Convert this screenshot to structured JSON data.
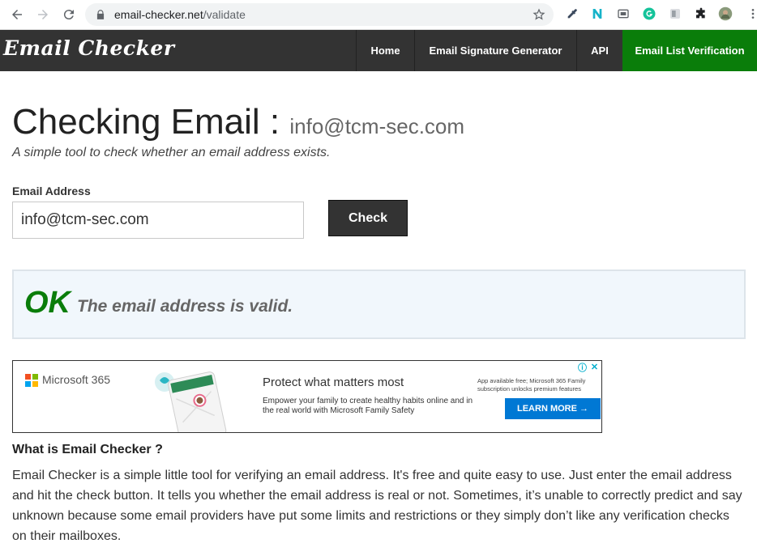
{
  "browser": {
    "url_host": "email-checker.net",
    "url_path": "/validate"
  },
  "site": {
    "logo": "Email Checker",
    "nav": [
      {
        "label": "Home"
      },
      {
        "label": "Email Signature Generator"
      },
      {
        "label": "API"
      },
      {
        "label": "Email List Verification"
      }
    ],
    "accent_color": "#0a7d0a"
  },
  "main": {
    "title": "Checking Email :",
    "title_email": "info@tcm-sec.com",
    "subtitle": "A simple tool to check whether an email address exists.",
    "field_label": "Email Address",
    "field_value": "info@tcm-sec.com",
    "check_label": "Check",
    "result_status": "OK",
    "result_message": "The email address is valid."
  },
  "ad": {
    "brand": "Microsoft 365",
    "headline": "Protect what matters most",
    "body": "Empower your family to create healthy habits online and in the real world with Microsoft Family Safety",
    "small": "App available free; Microsoft 365 Family subscription unlocks premium features",
    "cta": "LEARN MORE →"
  },
  "about": {
    "heading": "What is Email Checker ?",
    "text": "Email Checker is a simple little tool for verifying an email address. It's free and quite easy to use. Just enter the email address and hit the check button. It tells you whether the email address is real or not. Sometimes, it’s unable to correctly predict and say unknown because some email providers have put some limits and restrictions or they simply don’t like any verification checks on their mailboxes."
  }
}
